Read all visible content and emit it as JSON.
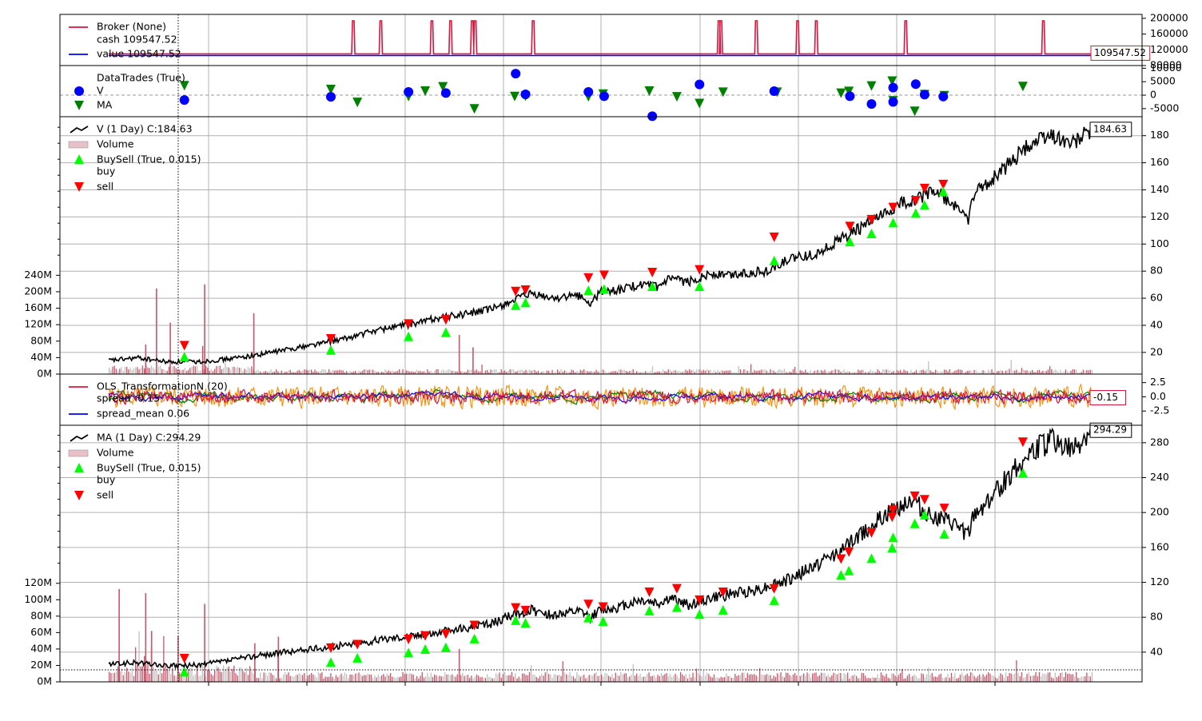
{
  "colors": {
    "price_line": "#000000",
    "broker_cash": "#dc143c",
    "broker_value": "#0000ff",
    "trade_marker": "#0000ff",
    "trade_marker_b": "#008000",
    "buy_marker": "#00ff00",
    "sell_marker": "#ff0000",
    "spread": "#dc143c",
    "spread_mean": "#0000ff",
    "osc_orange": "#ff8c00",
    "osc_green": "#008000",
    "volume_up": "#c0c0c0",
    "volume_down": "#c8566a",
    "grid": "#b0b0b0"
  },
  "chart_data": [
    {
      "panel": "broker",
      "type": "line",
      "legend": [
        "Broker (None)",
        "cash 109547.52",
        "value 109547.52"
      ],
      "y_ticks": [
        "200000",
        "160000",
        "120000",
        "80000"
      ],
      "ylim": [
        80000,
        210000
      ],
      "last_value_label": "109547.52",
      "series": [
        {
          "name": "cash",
          "baseline": 109547.52,
          "spikes": [
            0.248,
            0.276,
            0.328,
            0.347,
            0.369,
            0.372,
            0.431,
            0.62,
            0.622,
            0.658,
            0.7,
            0.719,
            0.81,
            0.95
          ]
        },
        {
          "name": "value",
          "baseline": 109547.52
        }
      ]
    },
    {
      "panel": "trades",
      "type": "scatter",
      "legend": [
        "DataTrades (True)",
        "V",
        "MA"
      ],
      "y_ticks": [
        "10000",
        "5000",
        "0",
        "-5000"
      ],
      "ylim": [
        -8000,
        11000
      ],
      "series": [
        {
          "name": "V",
          "points": [
            [
              0.077,
              -1800
            ],
            [
              0.226,
              -600
            ],
            [
              0.305,
              1200
            ],
            [
              0.343,
              800
            ],
            [
              0.414,
              8000
            ],
            [
              0.424,
              300
            ],
            [
              0.488,
              1200
            ],
            [
              0.504,
              -400
            ],
            [
              0.553,
              -7800
            ],
            [
              0.601,
              4000
            ],
            [
              0.677,
              1500
            ],
            [
              0.754,
              -400
            ],
            [
              0.776,
              -3300
            ],
            [
              0.798,
              2800
            ],
            [
              0.798,
              -2500
            ],
            [
              0.821,
              4100
            ],
            [
              0.83,
              200
            ],
            [
              0.849,
              -500
            ]
          ]
        },
        {
          "name": "MA",
          "points": [
            [
              0.077,
              3800
            ],
            [
              0.226,
              2400
            ],
            [
              0.253,
              -2400
            ],
            [
              0.305,
              -200
            ],
            [
              0.322,
              1800
            ],
            [
              0.34,
              3400
            ],
            [
              0.372,
              -4800
            ],
            [
              0.413,
              -200
            ],
            [
              0.424,
              -100
            ],
            [
              0.488,
              -300
            ],
            [
              0.503,
              700
            ],
            [
              0.55,
              1800
            ],
            [
              0.578,
              -300
            ],
            [
              0.601,
              -2800
            ],
            [
              0.625,
              1400
            ],
            [
              0.68,
              1400
            ],
            [
              0.745,
              1000
            ],
            [
              0.753,
              1700
            ],
            [
              0.776,
              3700
            ],
            [
              0.797,
              5500
            ],
            [
              0.798,
              -1800
            ],
            [
              0.82,
              -5700
            ],
            [
              0.83,
              500
            ],
            [
              0.85,
              100
            ],
            [
              0.93,
              3500
            ]
          ]
        }
      ]
    },
    {
      "panel": "V",
      "type": "line",
      "legend": [
        "V (1 Day) C:184.63",
        "Volume",
        "BuySell (True, 0.015)",
        "buy",
        "sell"
      ],
      "y_ticks": [
        "180",
        "160",
        "140",
        "120",
        "100",
        "80",
        "60",
        "40",
        "20"
      ],
      "ylim": [
        4,
        194
      ],
      "volume_ticks": [
        "240M",
        "200M",
        "160M",
        "120M",
        "80M",
        "40M",
        "0M"
      ],
      "volume_max": 250,
      "last_value_label": "184.63",
      "close_path": [
        [
          0.0,
          14
        ],
        [
          0.03,
          16
        ],
        [
          0.06,
          13
        ],
        [
          0.09,
          13
        ],
        [
          0.12,
          15
        ],
        [
          0.15,
          18
        ],
        [
          0.18,
          22
        ],
        [
          0.21,
          26
        ],
        [
          0.24,
          30
        ],
        [
          0.27,
          36
        ],
        [
          0.29,
          39
        ],
        [
          0.31,
          41
        ],
        [
          0.33,
          45
        ],
        [
          0.36,
          48
        ],
        [
          0.39,
          52
        ],
        [
          0.41,
          58
        ],
        [
          0.43,
          63
        ],
        [
          0.45,
          60
        ],
        [
          0.48,
          62
        ],
        [
          0.49,
          55
        ],
        [
          0.5,
          65
        ],
        [
          0.52,
          66
        ],
        [
          0.54,
          70
        ],
        [
          0.56,
          68
        ],
        [
          0.57,
          74
        ],
        [
          0.59,
          72
        ],
        [
          0.61,
          78
        ],
        [
          0.63,
          77
        ],
        [
          0.65,
          79
        ],
        [
          0.67,
          80
        ],
        [
          0.69,
          88
        ],
        [
          0.72,
          93
        ],
        [
          0.75,
          106
        ],
        [
          0.77,
          114
        ],
        [
          0.79,
          122
        ],
        [
          0.81,
          131
        ],
        [
          0.83,
          136
        ],
        [
          0.84,
          140
        ],
        [
          0.85,
          133
        ],
        [
          0.86,
          128
        ],
        [
          0.87,
          124
        ],
        [
          0.875,
          118
        ],
        [
          0.88,
          136
        ],
        [
          0.9,
          149
        ],
        [
          0.92,
          162
        ],
        [
          0.94,
          175
        ],
        [
          0.96,
          181
        ],
        [
          0.98,
          174
        ],
        [
          1.0,
          184.63
        ]
      ],
      "buys": [
        [
          0.077,
          21
        ],
        [
          0.226,
          26
        ],
        [
          0.305,
          36
        ],
        [
          0.343,
          39
        ],
        [
          0.414,
          59
        ],
        [
          0.424,
          61
        ],
        [
          0.488,
          70
        ],
        [
          0.504,
          71
        ],
        [
          0.553,
          73
        ],
        [
          0.601,
          73
        ],
        [
          0.677,
          92
        ],
        [
          0.754,
          106
        ],
        [
          0.776,
          112
        ],
        [
          0.798,
          120
        ],
        [
          0.821,
          127
        ],
        [
          0.83,
          133
        ],
        [
          0.849,
          143
        ]
      ],
      "sells": [
        [
          0.077,
          22
        ],
        [
          0.226,
          27
        ],
        [
          0.305,
          38
        ],
        [
          0.343,
          41
        ],
        [
          0.414,
          62
        ],
        [
          0.424,
          63
        ],
        [
          0.488,
          72
        ],
        [
          0.504,
          74
        ],
        [
          0.553,
          76
        ],
        [
          0.601,
          78
        ],
        [
          0.677,
          102
        ],
        [
          0.754,
          110
        ],
        [
          0.776,
          115
        ],
        [
          0.798,
          124
        ],
        [
          0.821,
          129
        ],
        [
          0.83,
          138
        ],
        [
          0.849,
          141
        ]
      ]
    },
    {
      "panel": "spread",
      "type": "line",
      "legend": [
        "OLS_TransformationN (20)",
        "spread -0.15",
        "spread_mean 0.06"
      ],
      "y_ticks": [
        "2.5",
        "0.0",
        "-2.5"
      ],
      "ylim": [
        -5,
        4
      ],
      "last_value_label": "-0.15",
      "series": [
        {
          "name": "spread",
          "last": -0.15
        },
        {
          "name": "spread_mean",
          "last": 0.06
        }
      ]
    },
    {
      "panel": "MA",
      "type": "line",
      "legend": [
        "MA (1 Day) C:294.29",
        "Volume",
        "BuySell (True, 0.015)",
        "buy",
        "sell"
      ],
      "y_ticks": [
        "280",
        "240",
        "200",
        "160",
        "120",
        "80",
        "40"
      ],
      "ylim": [
        6,
        300
      ],
      "volume_ticks": [
        "120M",
        "100M",
        "80M",
        "60M",
        "40M",
        "20M",
        "0M"
      ],
      "volume_max": 125,
      "last_value_label": "294.29",
      "close_path": [
        [
          0.0,
          26
        ],
        [
          0.03,
          28
        ],
        [
          0.06,
          24
        ],
        [
          0.09,
          25
        ],
        [
          0.12,
          30
        ],
        [
          0.15,
          36
        ],
        [
          0.18,
          40
        ],
        [
          0.21,
          44
        ],
        [
          0.24,
          48
        ],
        [
          0.27,
          53
        ],
        [
          0.29,
          57
        ],
        [
          0.31,
          59
        ],
        [
          0.33,
          62
        ],
        [
          0.36,
          67
        ],
        [
          0.39,
          73
        ],
        [
          0.41,
          82
        ],
        [
          0.43,
          88
        ],
        [
          0.45,
          83
        ],
        [
          0.48,
          86
        ],
        [
          0.49,
          80
        ],
        [
          0.5,
          88
        ],
        [
          0.52,
          92
        ],
        [
          0.54,
          100
        ],
        [
          0.56,
          96
        ],
        [
          0.57,
          102
        ],
        [
          0.59,
          94
        ],
        [
          0.61,
          101
        ],
        [
          0.63,
          106
        ],
        [
          0.66,
          112
        ],
        [
          0.69,
          122
        ],
        [
          0.72,
          140
        ],
        [
          0.75,
          160
        ],
        [
          0.77,
          180
        ],
        [
          0.79,
          196
        ],
        [
          0.81,
          212
        ],
        [
          0.82,
          214
        ],
        [
          0.83,
          200
        ],
        [
          0.85,
          190
        ],
        [
          0.86,
          186
        ],
        [
          0.875,
          174
        ],
        [
          0.88,
          196
        ],
        [
          0.9,
          220
        ],
        [
          0.92,
          248
        ],
        [
          0.94,
          270
        ],
        [
          0.96,
          284
        ],
        [
          0.98,
          270
        ],
        [
          1.0,
          294.29
        ]
      ],
      "buys": [
        [
          0.077,
          24
        ],
        [
          0.226,
          35
        ],
        [
          0.253,
          40
        ],
        [
          0.305,
          46
        ],
        [
          0.322,
          50
        ],
        [
          0.343,
          52
        ],
        [
          0.372,
          62
        ],
        [
          0.414,
          83
        ],
        [
          0.424,
          80
        ],
        [
          0.488,
          86
        ],
        [
          0.503,
          82
        ],
        [
          0.55,
          94
        ],
        [
          0.578,
          98
        ],
        [
          0.601,
          90
        ],
        [
          0.625,
          95
        ],
        [
          0.677,
          106
        ],
        [
          0.745,
          135
        ],
        [
          0.753,
          140
        ],
        [
          0.776,
          154
        ],
        [
          0.797,
          166
        ],
        [
          0.798,
          178
        ],
        [
          0.82,
          194
        ],
        [
          0.83,
          204
        ],
        [
          0.85,
          182
        ],
        [
          0.93,
          252
        ]
      ],
      "sells": [
        [
          0.077,
          28
        ],
        [
          0.226,
          40
        ],
        [
          0.253,
          44
        ],
        [
          0.305,
          50
        ],
        [
          0.322,
          54
        ],
        [
          0.343,
          56
        ],
        [
          0.372,
          66
        ],
        [
          0.414,
          86
        ],
        [
          0.424,
          83
        ],
        [
          0.488,
          90
        ],
        [
          0.503,
          87
        ],
        [
          0.55,
          104
        ],
        [
          0.578,
          108
        ],
        [
          0.601,
          95
        ],
        [
          0.625,
          104
        ],
        [
          0.677,
          108
        ],
        [
          0.745,
          142
        ],
        [
          0.753,
          150
        ],
        [
          0.776,
          172
        ],
        [
          0.797,
          190
        ],
        [
          0.798,
          198
        ],
        [
          0.82,
          214
        ],
        [
          0.83,
          210
        ],
        [
          0.85,
          200
        ],
        [
          0.93,
          276
        ]
      ]
    }
  ]
}
